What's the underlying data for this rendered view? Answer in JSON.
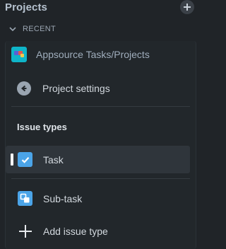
{
  "header": {
    "title": "Projects",
    "add_icon": "plus-icon"
  },
  "recent": {
    "label": "RECENT",
    "icon": "chevron-down-icon"
  },
  "project": {
    "name": "Appsource Tasks/Projects",
    "avatar_color": "#0fb5c9"
  },
  "settings": {
    "label": "Project settings",
    "icon": "arrow-left-icon"
  },
  "issue_types": {
    "title": "Issue types",
    "items": [
      {
        "label": "Task",
        "icon": "task-check-icon",
        "active": true
      },
      {
        "label": "Sub-task",
        "icon": "subtask-icon",
        "active": false
      }
    ],
    "add_label": "Add issue type"
  },
  "colors": {
    "background": "#202428",
    "panel": "#22272b",
    "active_row": "#2f353b",
    "issue_icon_blue": "#4ba4e8"
  }
}
